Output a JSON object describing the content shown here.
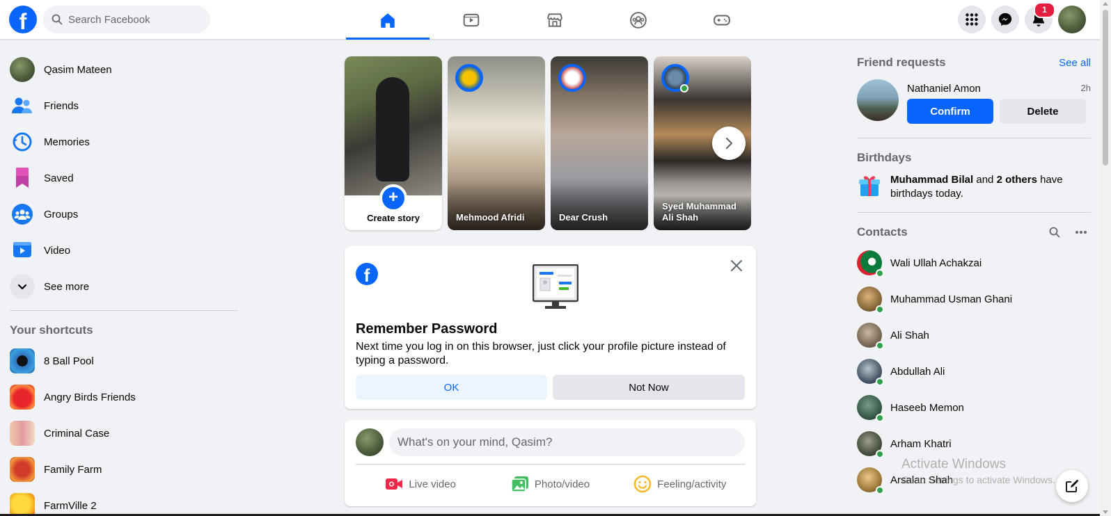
{
  "topbar": {
    "logo_letter": "f",
    "search_placeholder": "Search Facebook",
    "tabs": [
      {
        "name": "home",
        "active": true
      },
      {
        "name": "watch",
        "active": false
      },
      {
        "name": "marketplace",
        "active": false
      },
      {
        "name": "groups",
        "active": false
      },
      {
        "name": "gaming",
        "active": false
      }
    ],
    "notification_count": "1"
  },
  "left_nav": {
    "items": [
      {
        "label": "Qasim Mateen",
        "icon": "profile-avatar"
      },
      {
        "label": "Friends",
        "icon": "friends-icon"
      },
      {
        "label": "Memories",
        "icon": "memories-icon"
      },
      {
        "label": "Saved",
        "icon": "saved-icon"
      },
      {
        "label": "Groups",
        "icon": "groups-icon"
      },
      {
        "label": "Video",
        "icon": "video-icon"
      },
      {
        "label": "See more",
        "icon": "chevron-down-icon"
      }
    ],
    "shortcuts_title": "Your shortcuts",
    "shortcuts": [
      {
        "label": "8 Ball Pool"
      },
      {
        "label": "Angry Birds Friends"
      },
      {
        "label": "Criminal Case"
      },
      {
        "label": "Family Farm"
      },
      {
        "label": "FarmVille 2"
      }
    ]
  },
  "stories": {
    "create_label": "Create story",
    "items": [
      {
        "name": "Mehmood Afridi"
      },
      {
        "name": "Dear Crush"
      },
      {
        "name": "Syed Muhammad Ali Shah"
      }
    ]
  },
  "remember_password": {
    "logo_letter": "f",
    "title": "Remember Password",
    "text": "Next time you log in on this browser, just click your profile picture instead of typing a password.",
    "ok_label": "OK",
    "not_now_label": "Not Now"
  },
  "composer": {
    "placeholder": "What's on your mind, Qasim?",
    "actions": [
      {
        "label": "Live video",
        "color": "#f02849"
      },
      {
        "label": "Photo/video",
        "color": "#45bd62"
      },
      {
        "label": "Feeling/activity",
        "color": "#f7b928"
      }
    ]
  },
  "friend_requests": {
    "title": "Friend requests",
    "see_all": "See all",
    "request": {
      "name": "Nathaniel Amon",
      "time": "2h",
      "confirm_label": "Confirm",
      "delete_label": "Delete"
    }
  },
  "birthdays": {
    "title": "Birthdays",
    "name": "Muhammad Bilal",
    "and_text": " and ",
    "others": "2 others",
    "suffix": " have birthdays today."
  },
  "contacts": {
    "title": "Contacts",
    "items": [
      {
        "name": "Wali Ullah Achakzai"
      },
      {
        "name": "Muhammad Usman Ghani"
      },
      {
        "name": "Ali Shah"
      },
      {
        "name": "Abdullah Ali"
      },
      {
        "name": "Haseeb Memon"
      },
      {
        "name": "Arham Khatri"
      },
      {
        "name": "Arsalan Shah"
      }
    ]
  },
  "watermark": {
    "line1": "Activate Windows",
    "line2": "Go to Settings to activate Windows."
  },
  "colors": {
    "brand": "#0866ff",
    "background": "#f0f2f5",
    "online": "#31a24c",
    "badge": "#e41e3f"
  }
}
